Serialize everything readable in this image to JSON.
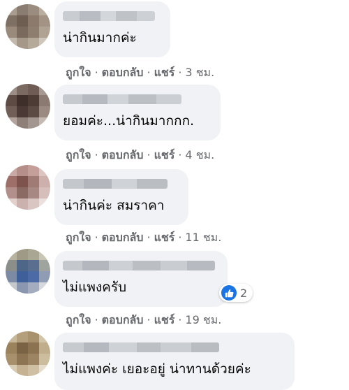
{
  "comments": [
    {
      "text": "น่ากินมากค่ะ",
      "time": "3 ชม.",
      "avatar_colors": [
        "#a89c8e",
        "#8a7c70",
        "#9a8d80",
        "#b8ad9e",
        "#7f7064",
        "#6e5e52",
        "#8c7b6d",
        "#a39384",
        "#998a7c",
        "#7a6a5d",
        "#8e7e70",
        "#b0a393",
        "#c2b8ab",
        "#a59888",
        "#b5a99a",
        "#cfc6bb"
      ]
    },
    {
      "text": "ยอมค่ะ...น่ากินมากกก.",
      "time": "4 ชม.",
      "avatar_colors": [
        "#9c8e87",
        "#7b6a62",
        "#6e5c55",
        "#a69890",
        "#5e4b44",
        "#3f2f2a",
        "#4d3b35",
        "#8b7a72",
        "#705e57",
        "#4a3934",
        "#5c4a44",
        "#9a8a82",
        "#b3a59e",
        "#8e7f78",
        "#a39690",
        "#c4b9b3"
      ]
    },
    {
      "text": "น่ากินค่ะ สมราคา",
      "time": "11 ชม.",
      "avatar_colors": [
        "#c9a9a6",
        "#b58e89",
        "#c49f9a",
        "#dcc4c1",
        "#9e6f69",
        "#7e534d",
        "#a07a74",
        "#cdb0ac",
        "#b38f8b",
        "#8c6a64",
        "#a88883",
        "#d6bfbb",
        "#e2d0cd",
        "#cbb2ae",
        "#d9c5c2",
        "#ece0de"
      ]
    },
    {
      "text": "ไม่แพงครับ",
      "time": "19 ชม.",
      "reactions": "2",
      "avatar_colors": [
        "#b7b39f",
        "#9f9a86",
        "#a9a793",
        "#c8c5b4",
        "#8c8e8a",
        "#4e6687",
        "#5a6f8f",
        "#a0a49e",
        "#7d8aa3",
        "#3f5f9a",
        "#4c6aa6",
        "#8f9cb3",
        "#c6c9cc",
        "#8a97ae",
        "#a3adbf",
        "#d5d8dc"
      ]
    },
    {
      "text": "ไม่แพงค่ะ เยอะอยู่ น่าทานด้วยค่ะ",
      "avatar_colors": [
        "#c8b89a",
        "#b49f7c",
        "#a8926e",
        "#d2c4a8",
        "#9a825d",
        "#7a6244",
        "#8b7352",
        "#c0ad8c",
        "#a8906c",
        "#8d7553",
        "#9c8462",
        "#cdbd9f",
        "#d9ccb4",
        "#c4b293",
        "#cfc0a4",
        "#e6dccb"
      ]
    }
  ],
  "actions": {
    "like": "ถูกใจ",
    "reply": "ตอบกลับ",
    "share": "แชร์",
    "separator": "·"
  }
}
